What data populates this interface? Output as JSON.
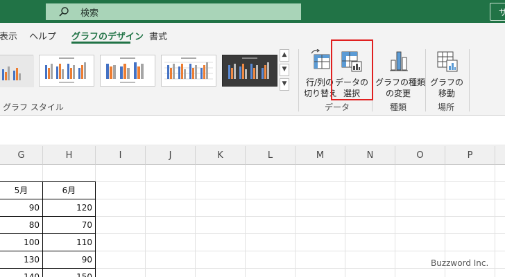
{
  "titlebar": {
    "search_label": "検索",
    "signin_label": "サ"
  },
  "tabs": {
    "items": [
      "表示",
      "ヘルプ",
      "グラフのデザイン",
      "書式"
    ],
    "active": "グラフのデザイン"
  },
  "ribbon": {
    "chart_styles_label": "グラフ スタイル",
    "groups": {
      "data": {
        "label": "データ",
        "switch_row_col": [
          "行/列の",
          "切り替え"
        ],
        "select_data": [
          "データの",
          "選択"
        ]
      },
      "type": {
        "label": "種類",
        "change_type": [
          "グラフの種類",
          "の変更"
        ]
      },
      "location": {
        "label": "場所",
        "move_chart": [
          "グラフの",
          "移動"
        ]
      }
    },
    "gallery_arrows": [
      "▲",
      "▼",
      "▼"
    ]
  },
  "grid": {
    "columns": [
      "G",
      "H",
      "I",
      "J",
      "K",
      "L",
      "M",
      "N",
      "O",
      "P"
    ],
    "month_headers": [
      "5月",
      "6月"
    ],
    "rows": [
      [
        "90",
        "120"
      ],
      [
        "80",
        "70"
      ],
      [
        "100",
        "110"
      ],
      [
        "130",
        "90"
      ],
      [
        "140",
        "150"
      ]
    ]
  },
  "watermark": "Buzzword Inc.",
  "colors": {
    "accent": "#217346",
    "highlight": "#e02020",
    "chart_blue": "#4472c4",
    "chart_orange": "#ed7d31",
    "chart_gray": "#a5a5a5"
  }
}
